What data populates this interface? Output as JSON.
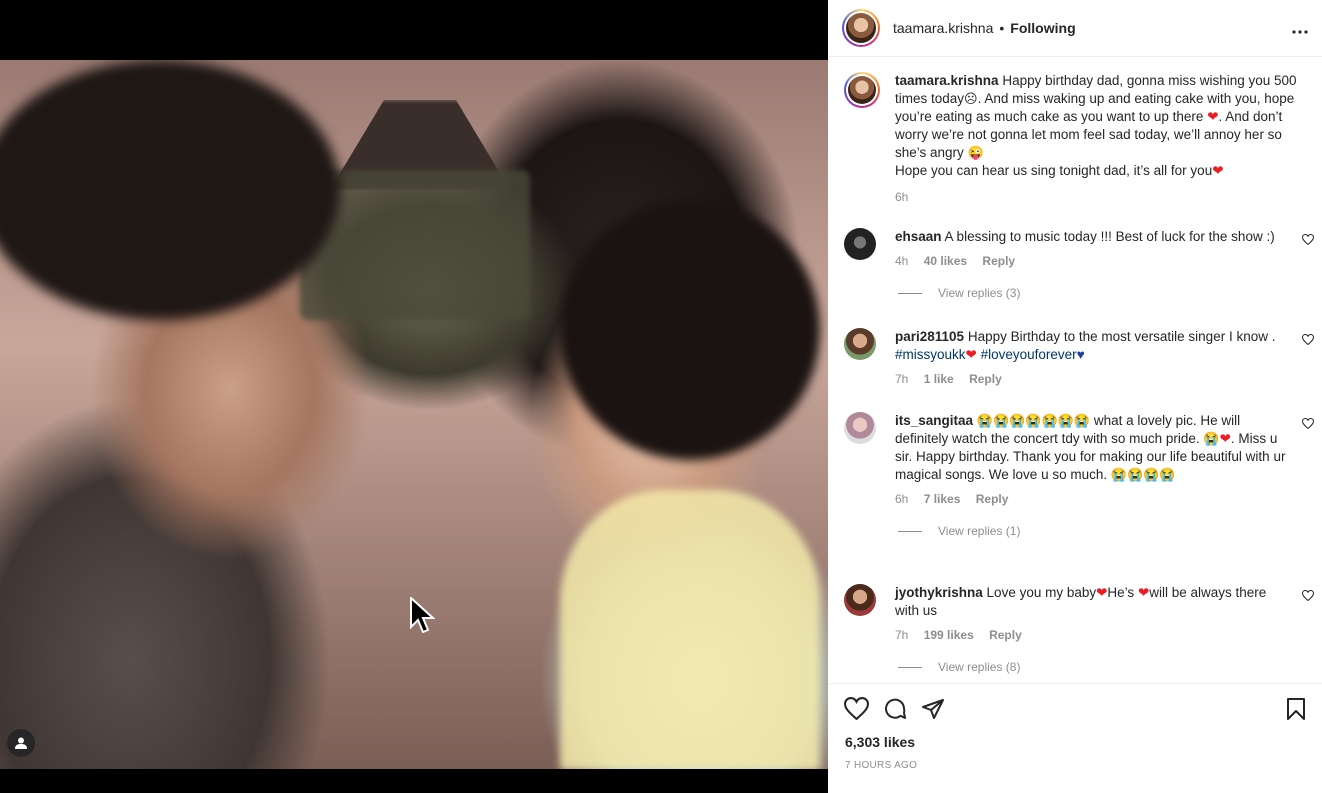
{
  "post": {
    "author": "taamara.krishna",
    "separator": "•",
    "follow_status": "Following",
    "more_icon": "more-horizontal-icon"
  },
  "caption": {
    "username": "taamara.krishna",
    "text_1": "Happy birthday dad, gonna miss wishing you 500 times today",
    "emoji_1": "☹",
    "text_2": ". And miss waking up and eating cake with you, hope you’re eating as much cake as you want to up there ",
    "emoji_2": "❤",
    "text_3": ". And don’t worry we’re not gonna let mom feel sad today, we’ll annoy her so she’s angry ",
    "emoji_3": "😜",
    "text_4": "Hope you can hear us sing tonight dad, it’s all for you",
    "emoji_4": "❤",
    "time": "6h"
  },
  "comments": [
    {
      "username": "ehsaan",
      "text": "A blessing to music today !!! Best of luck for the show :)",
      "time": "4h",
      "likes": "40 likes",
      "reply": "Reply",
      "view_replies": "View replies (3)"
    },
    {
      "username": "pari281105",
      "text": "Happy Birthday to the most versatile singer I know .",
      "tag1": "#missyoukk",
      "tag2": "#loveyouforever",
      "time": "7h",
      "likes": "1 like",
      "reply": "Reply"
    },
    {
      "username": "its_sangitaa",
      "emoji_run": "😭😭😭😭😭😭😭",
      "text_1": " what a lovely pic. He will definitely watch the concert tdy with so much pride. ",
      "emoji_2": "😭",
      "heart": "❤",
      "text_2": ". Miss u sir. Happy birthday. Thank you for making our life beautiful with ur magical songs. We love u so much. ",
      "emoji_3": "😭😭😭😭",
      "time": "6h",
      "likes": "7 likes",
      "reply": "Reply",
      "view_replies": "View replies (1)"
    },
    {
      "username": "jyothykrishna",
      "text_1": "Love you my baby",
      "heart": "❤",
      "text_2": "He’s ",
      "text_3": "will be always there with us",
      "time": "7h",
      "likes": "199 likes",
      "reply": "Reply",
      "view_replies": "View replies (8)"
    }
  ],
  "footer": {
    "likes": "6,303 likes",
    "posted": "7 HOURS AGO"
  },
  "colors": {
    "accent_link": "#00376b",
    "muted": "#8e8e8e",
    "text": "#262626"
  }
}
